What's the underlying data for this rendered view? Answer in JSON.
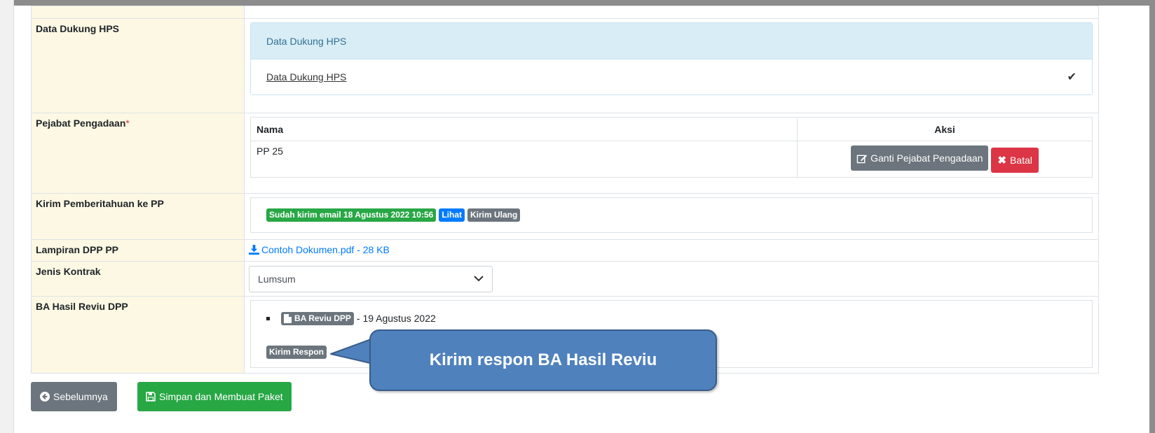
{
  "rows": {
    "data_dukung": {
      "label": "Data Dukung HPS",
      "panel_title": "Data Dukung HPS",
      "doc_link": "Data Dukung HPS",
      "check_icon": "✔"
    },
    "pejabat": {
      "label": "Pejabat Pengadaan",
      "required_mark": "*",
      "col_nama": "Nama",
      "col_aksi": "Aksi",
      "nama_value": "PP 25",
      "ganti_button": "Ganti Pejabat Pengadaan",
      "batal_button": "Batal"
    },
    "kirim_pemberitahuan": {
      "label": "Kirim Pemberitahuan ke PP",
      "status_badge": "Sudah kirim email 18 Agustus 2022 10:56",
      "lihat_badge": "Lihat",
      "kirim_ulang_badge": "Kirim Ulang"
    },
    "lampiran": {
      "label": "Lampiran DPP PP",
      "file_link": "Contoh Dokumen.pdf - 28 KB"
    },
    "jenis_kontrak": {
      "label": "Jenis Kontrak",
      "selected": "Lumsum"
    },
    "ba_hasil": {
      "label": "BA Hasil Reviu DPP",
      "doc_badge": "BA Reviu DPP",
      "doc_date": "- 19 Agustus 2022",
      "kirim_respon_badge": "Kirim Respon"
    }
  },
  "footer": {
    "sebelumnya_button": "Sebelumnya",
    "simpan_button": "Simpan dan Membuat Paket"
  },
  "callout": {
    "text": "Kirim respon BA Hasil Reviu"
  },
  "colors": {
    "label_bg": "#fcf8e3",
    "panel_head_bg": "#d9edf7",
    "callout_bg": "#4f81bd",
    "green": "#28a745",
    "blue": "#007bff",
    "gray": "#6c757d",
    "red": "#dc3545"
  },
  "icons": {
    "edit": "edit-icon",
    "close": "close-icon",
    "download": "download-icon",
    "file": "file-icon",
    "arrow_left": "arrow-left-circle-icon",
    "save": "save-icon",
    "chevron": "chevron-down-icon"
  }
}
